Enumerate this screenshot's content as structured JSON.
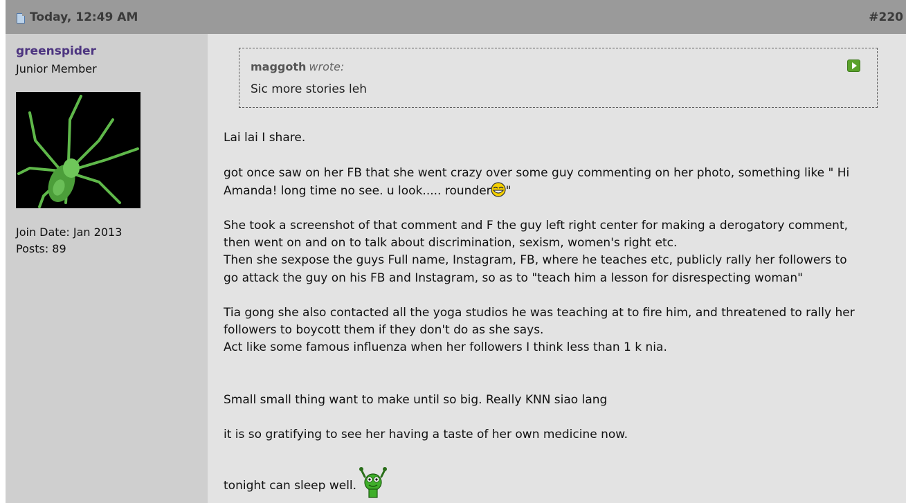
{
  "header": {
    "date": "Today, 12:49 AM",
    "post_number": "#220"
  },
  "author": {
    "username": "greenspider",
    "title": "Junior Member",
    "join_date": "Join Date: Jan 2013",
    "posts": "Posts: 89",
    "avatar_icon": "green-spider-avatar"
  },
  "quote": {
    "author": "maggoth",
    "wrote": "wrote:",
    "text": "Sic more stories leh",
    "goto_icon": "view-post-icon"
  },
  "message": {
    "line1": "Lai lai I share.",
    "line2": "got once saw on her FB that she went crazy over some guy commenting on her photo, something like \" Hi",
    "line3a": "Amanda! long time no see. u look..... rounder",
    "line3b": "\"",
    "line4": "She took a screenshot of that comment and F the guy left right center for making a derogatory comment,",
    "line5": "then went on and on to talk about discrimination, sexism, women's right etc.",
    "line6": "Then she sexpose the guys Full name, Instagram, FB, where he teaches etc, publicly rally her followers to",
    "line7": "go attack the guy on his FB and Instagram, so as to \"teach him a lesson for disrespecting woman\"",
    "line8": "Tia gong she also contacted all the yoga studios he was teaching at to fire him, and threatened to rally her",
    "line9": "followers to boycott them if they don't do as she says.",
    "line10": "Act like some famous influenza when her followers I think less than 1 k nia.",
    "line11": "Small small thing want to make until so big. Really KNN siao lang",
    "line12": "it is so gratifying to see her having a taste of her own medicine now.",
    "line13": "tonight can sleep well.",
    "smiley_icon": "laughing-smiley-icon",
    "alien_icon": "green-alien-smiley-icon"
  }
}
